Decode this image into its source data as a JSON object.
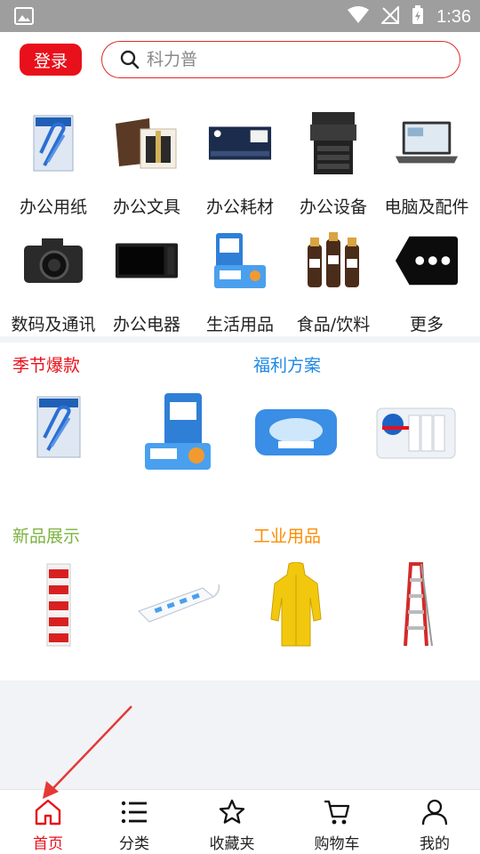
{
  "status_bar": {
    "time": "1:36",
    "icons": [
      "image-icon",
      "wifi-icon",
      "no-signal-icon",
      "battery-charging-icon"
    ]
  },
  "header": {
    "login_label": "登录",
    "search_placeholder": "科力普"
  },
  "categories": [
    {
      "label": "办公用纸",
      "icon": "paper-clip-pack-icon"
    },
    {
      "label": "办公文具",
      "icon": "pen-gift-box-icon"
    },
    {
      "label": "办公耗材",
      "icon": "toner-cartridge-icon"
    },
    {
      "label": "办公设备",
      "icon": "copier-icon"
    },
    {
      "label": "电脑及配件",
      "icon": "laptop-icon"
    },
    {
      "label": "数码及通讯",
      "icon": "camera-icon"
    },
    {
      "label": "办公电器",
      "icon": "microwave-icon"
    },
    {
      "label": "生活用品",
      "icon": "tissue-pack-icon"
    },
    {
      "label": "食品/饮料",
      "icon": "coffee-bottles-icon"
    },
    {
      "label": "更多",
      "icon": "more-icon"
    }
  ],
  "sections": [
    {
      "title": "季节爆款",
      "color": "#e8101b",
      "products": [
        "paper-clip-pack-icon",
        "tissue-pack-icon"
      ]
    },
    {
      "title": "福利方案",
      "color": "#1e88e5",
      "products": [
        "wet-wipes-icon",
        "paper-cups-icon"
      ]
    },
    {
      "title": "新品展示",
      "color": "#7cb342",
      "products": [
        "battery-pack-icon",
        "power-strip-icon"
      ]
    },
    {
      "title": "工业用品",
      "color": "#fb8c00",
      "products": [
        "raincoat-icon",
        "ladder-icon"
      ]
    }
  ],
  "bottom_nav": [
    {
      "label": "首页",
      "icon": "home-icon",
      "active": true
    },
    {
      "label": "分类",
      "icon": "list-icon",
      "active": false
    },
    {
      "label": "收藏夹",
      "icon": "star-icon",
      "active": false
    },
    {
      "label": "购物车",
      "icon": "cart-icon",
      "active": false
    },
    {
      "label": "我的",
      "icon": "user-icon",
      "active": false
    }
  ],
  "colors": {
    "accent": "#e8101b",
    "status_bar": "#9e9e9e",
    "background": "#f1f3f7"
  }
}
